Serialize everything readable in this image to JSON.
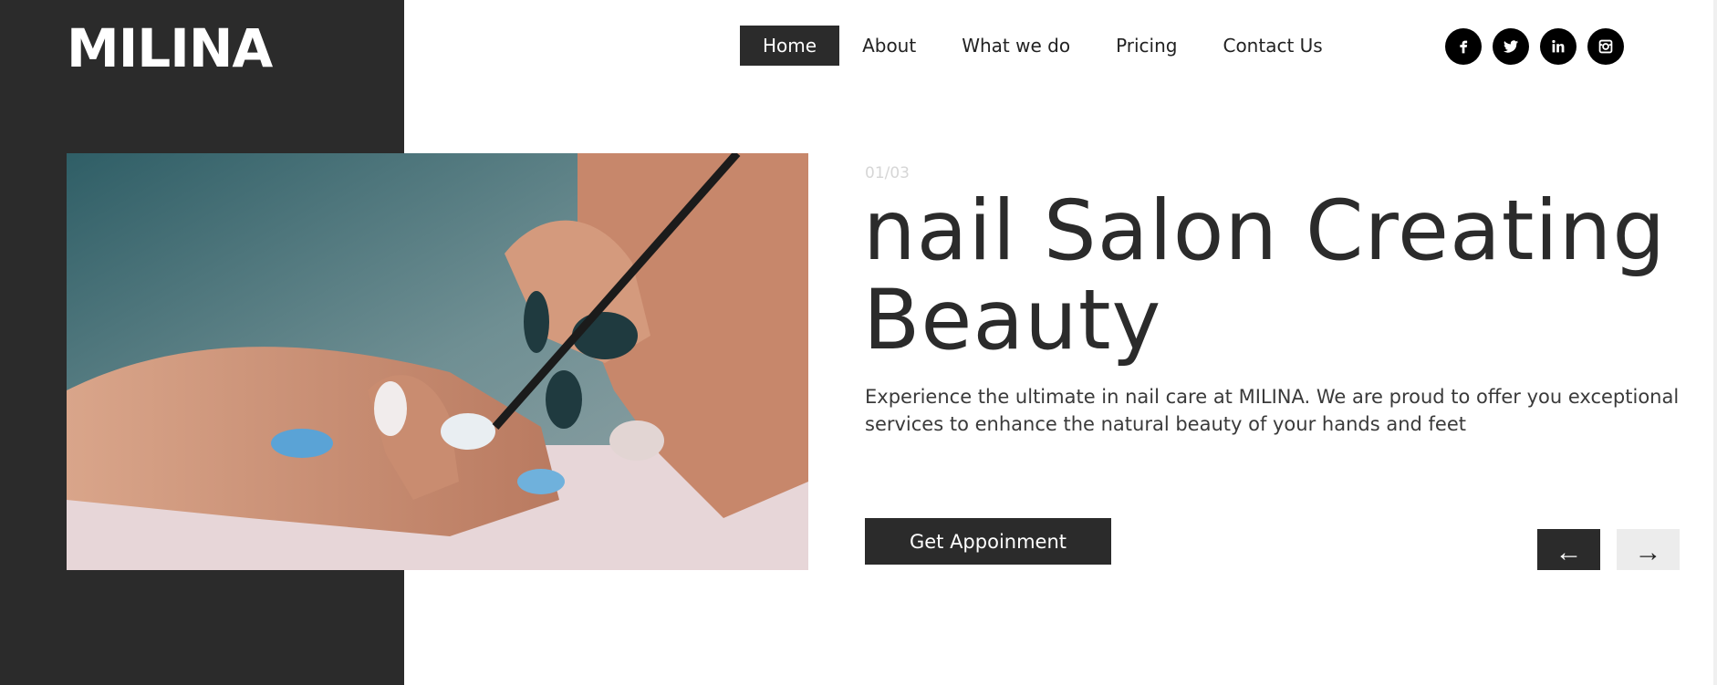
{
  "brand": {
    "logo": "MILINA"
  },
  "nav": {
    "items": [
      {
        "label": "Home",
        "active": true
      },
      {
        "label": "About",
        "active": false
      },
      {
        "label": "What we do",
        "active": false
      },
      {
        "label": "Pricing",
        "active": false
      },
      {
        "label": "Contact Us",
        "active": false
      }
    ]
  },
  "social": {
    "icons": [
      "facebook-icon",
      "twitter-icon",
      "linkedin-icon",
      "instagram-icon"
    ]
  },
  "hero": {
    "image": "nail-art-manicure-photo",
    "counter": "01/03",
    "headline_line1": "nail Salon Creating",
    "headline_line2": "Beauty",
    "description": "Experience the ultimate in nail care at MILINA. We are proud to offer you exceptional services to enhance the natural beauty of your hands and feet",
    "cta_label": "Get Appoinment",
    "prev_arrow": "←",
    "next_arrow": "→"
  },
  "colors": {
    "dark": "#2b2b2b",
    "white": "#ffffff",
    "counter": "#d6d6d6",
    "next_bg": "#ececec"
  }
}
